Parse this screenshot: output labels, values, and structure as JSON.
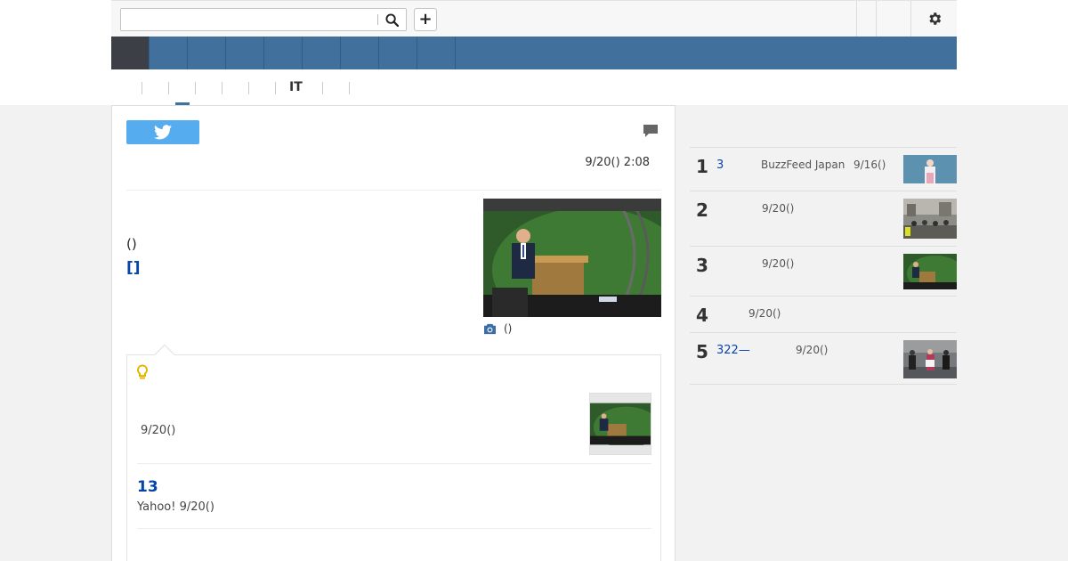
{
  "header": {
    "search_placeholder": "",
    "plus_label": "+"
  },
  "nav": {
    "items": [
      "",
      "",
      "",
      "",
      "",
      "",
      "",
      "",
      ""
    ]
  },
  "subtabs": {
    "active_label": "IT"
  },
  "article": {
    "datetime": "9/20() 2:08",
    "paren_text": "()",
    "link_text": "[]",
    "photo_caption": "()"
  },
  "related": {
    "item1_date": "9/20()",
    "item2_number": "13",
    "item2_source": "Yahoo! 9/20()"
  },
  "ranking": [
    {
      "rank": "1",
      "link": "3",
      "source": "BuzzFeed Japan",
      "date": "9/16()"
    },
    {
      "rank": "2",
      "link": "",
      "source": "",
      "date": "9/20()"
    },
    {
      "rank": "3",
      "link": "",
      "source": "",
      "date": "9/20()"
    },
    {
      "rank": "4",
      "link": "",
      "source": "",
      "date": "9/20()"
    },
    {
      "rank": "5",
      "link": "322—",
      "source": "",
      "date": "9/20()"
    }
  ],
  "colors": {
    "nav_blue": "#40709b",
    "nav_active": "#3c3f45",
    "twitter_blue": "#55acee",
    "link_blue": "#0645a8",
    "bulb_yellow": "#e8b400"
  },
  "icons": [
    "search-icon",
    "plus-icon",
    "gear-icon",
    "twitter-icon",
    "comment-icon",
    "camera-icon",
    "lightbulb-icon"
  ]
}
